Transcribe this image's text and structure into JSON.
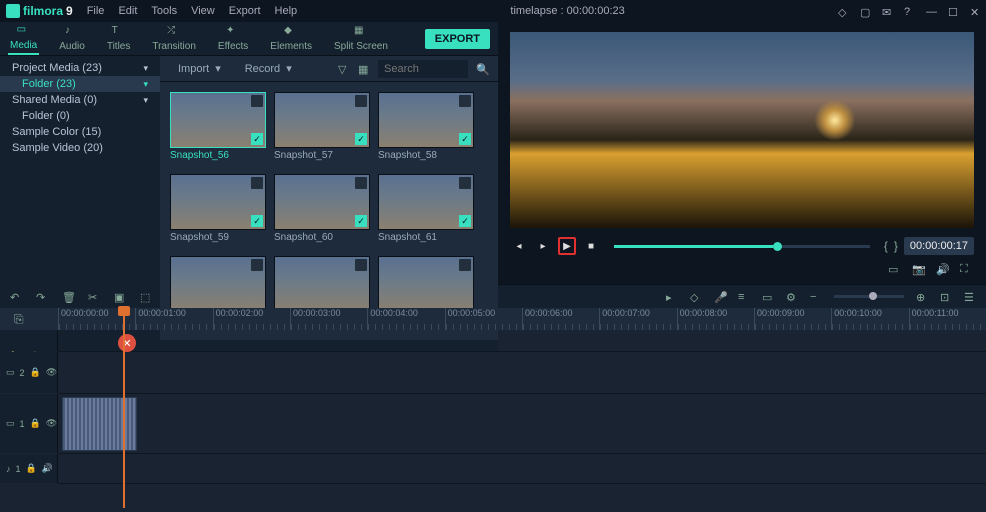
{
  "app": {
    "name": "filmora",
    "version": "9"
  },
  "titlebar": {
    "title": "timelapse : 00:00:00:23"
  },
  "menubar": [
    "File",
    "Edit",
    "Tools",
    "View",
    "Export",
    "Help"
  ],
  "tabs": [
    {
      "label": "Media",
      "active": true
    },
    {
      "label": "Audio"
    },
    {
      "label": "Titles"
    },
    {
      "label": "Transition"
    },
    {
      "label": "Effects"
    },
    {
      "label": "Elements"
    },
    {
      "label": "Split Screen"
    }
  ],
  "export_btn": "EXPORT",
  "tree": [
    {
      "label": "Project Media (23)",
      "expand": true
    },
    {
      "label": "Folder (23)",
      "sub": true,
      "sel": true,
      "expand": true
    },
    {
      "label": "Shared Media (0)",
      "expand": true
    },
    {
      "label": "Folder (0)",
      "sub": true
    },
    {
      "label": "Sample Color (15)"
    },
    {
      "label": "Sample Video (20)"
    }
  ],
  "media_toolbar": {
    "import": "Import",
    "record": "Record",
    "search_ph": "Search"
  },
  "thumbs": [
    {
      "label": "Snapshot_56",
      "sel": true,
      "check": true
    },
    {
      "label": "Snapshot_57",
      "check": true
    },
    {
      "label": "Snapshot_58",
      "check": true
    },
    {
      "label": "Snapshot_59",
      "check": true
    },
    {
      "label": "Snapshot_60",
      "check": true
    },
    {
      "label": "Snapshot_61",
      "check": true
    },
    {
      "label": "",
      "check": false
    },
    {
      "label": "",
      "check": false
    },
    {
      "label": "",
      "check": false
    }
  ],
  "preview": {
    "timecode": "00:00:00:17"
  },
  "ruler": [
    "00:00:00:00",
    "00:00:01:00",
    "00:00:02:00",
    "00:00:03:00",
    "00:00:04:00",
    "00:00:05:00",
    "00:00:06:00",
    "00:00:07:00",
    "00:00:08:00",
    "00:00:09:00",
    "00:00:10:00",
    "00:00:11:00"
  ],
  "tracks": {
    "t2": "2",
    "t1": "1",
    "a1": "1"
  },
  "icons": {
    "lock": "🔒",
    "eye": "👁",
    "vol": "🔊",
    "link": "⎘"
  }
}
